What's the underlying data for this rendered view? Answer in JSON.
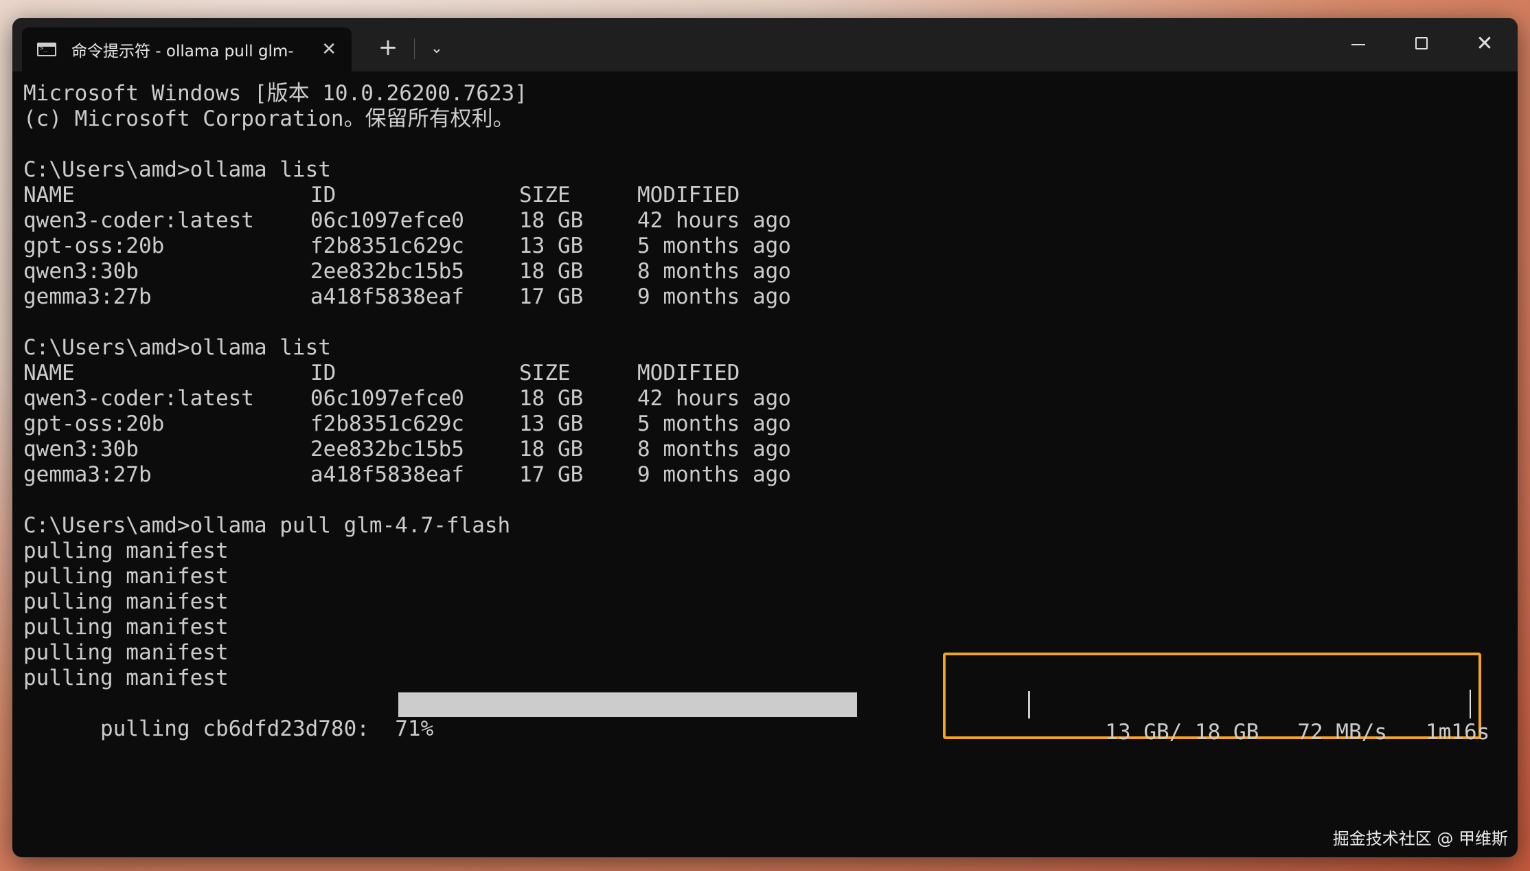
{
  "window": {
    "tab_title": "命令提示符 - ollama  pull glm-",
    "tab_close": "✕",
    "new_tab": "+",
    "dropdown": "⌄",
    "close_glyph": "✕"
  },
  "terminal": {
    "banner": [
      "Microsoft Windows [版本 10.0.26200.7623]",
      "(c) Microsoft Corporation。保留所有权利。"
    ],
    "prompt1": "C:\\Users\\amd>ollama list",
    "prompt2": "C:\\Users\\amd>ollama list",
    "table_headers": [
      "NAME",
      "ID",
      "SIZE",
      "MODIFIED"
    ],
    "models": [
      {
        "name": "qwen3-coder:latest",
        "id": "06c1097efce0",
        "size": "18 GB",
        "modified": "42 hours ago"
      },
      {
        "name": "gpt-oss:20b",
        "id": "f2b8351c629c",
        "size": "13 GB",
        "modified": "5 months ago"
      },
      {
        "name": "qwen3:30b",
        "id": "2ee832bc15b5",
        "size": "18 GB",
        "modified": "8 months ago"
      },
      {
        "name": "gemma3:27b",
        "id": "a418f5838eaf",
        "size": "17 GB",
        "modified": "9 months ago"
      }
    ],
    "prompt3": "C:\\Users\\amd>ollama pull glm-4.7-flash",
    "manifest_lines": [
      "pulling manifest",
      "pulling manifest",
      "pulling manifest",
      "pulling manifest",
      "pulling manifest",
      "pulling manifest"
    ],
    "pull_label": "pulling cb6dfd23d780:  71%",
    "progress_fraction": 0.71,
    "transferred": "13 GB/ 18 GB",
    "speed": "72 MB/s",
    "eta": "1m16s"
  },
  "colors": {
    "terminal_bg": "#0c0c0c",
    "terminal_fg": "#cccccc",
    "highlight": "#f3a61d"
  },
  "watermark": "掘金技术社区 @ 甲维斯"
}
